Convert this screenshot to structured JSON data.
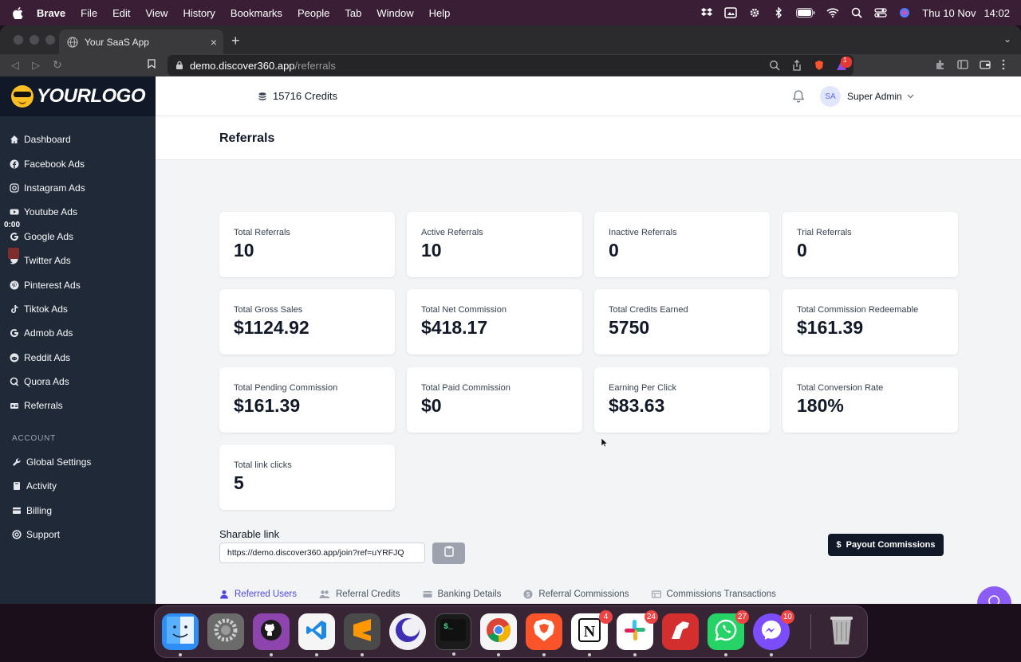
{
  "menubar": {
    "app_name": "Brave",
    "menus": [
      "File",
      "Edit",
      "View",
      "History",
      "Bookmarks",
      "People",
      "Tab",
      "Window",
      "Help"
    ],
    "date": "Thu 10 Nov",
    "time": "14:02"
  },
  "browser": {
    "tab_title": "Your SaaS App",
    "url_host": "demo.discover360.app",
    "url_path": "/referrals",
    "new_tab_symbol": "+",
    "shields_badge": "1"
  },
  "sidebar": {
    "logo_text": "YOURLOGO",
    "timer": "0:00",
    "items": [
      {
        "label": "Dashboard",
        "icon": "home-icon"
      },
      {
        "label": "Facebook Ads",
        "icon": "facebook-icon"
      },
      {
        "label": "Instagram Ads",
        "icon": "instagram-icon"
      },
      {
        "label": "Youtube Ads",
        "icon": "youtube-icon"
      },
      {
        "label": "Google Ads",
        "icon": "google-icon"
      },
      {
        "label": "Twitter Ads",
        "icon": "twitter-icon"
      },
      {
        "label": "Pinterest Ads",
        "icon": "pinterest-icon"
      },
      {
        "label": "Tiktok Ads",
        "icon": "tiktok-icon"
      },
      {
        "label": "Admob Ads",
        "icon": "admob-icon"
      },
      {
        "label": "Reddit Ads",
        "icon": "reddit-icon"
      },
      {
        "label": "Quora Ads",
        "icon": "quora-icon"
      },
      {
        "label": "Referrals",
        "icon": "referrals-icon"
      }
    ],
    "account_label": "ACCOUNT",
    "account_items": [
      {
        "label": "Global Settings",
        "icon": "wrench-icon"
      },
      {
        "label": "Activity",
        "icon": "book-icon"
      },
      {
        "label": "Billing",
        "icon": "billing-icon"
      },
      {
        "label": "Support",
        "icon": "support-icon"
      }
    ]
  },
  "header": {
    "credits": "15716 Credits",
    "avatar_initials": "SA",
    "user_name": "Super Admin"
  },
  "page": {
    "title": "Referrals"
  },
  "stats": [
    {
      "label": "Total Referrals",
      "value": "10"
    },
    {
      "label": "Active Referrals",
      "value": "10"
    },
    {
      "label": "Inactive Referrals",
      "value": "0"
    },
    {
      "label": "Trial Referrals",
      "value": "0"
    },
    {
      "label": "Total Gross Sales",
      "value": "$1124.92"
    },
    {
      "label": "Total Net Commission",
      "value": "$418.17"
    },
    {
      "label": "Total Credits Earned",
      "value": "5750"
    },
    {
      "label": "Total Commission Redeemable",
      "value": "$161.39"
    },
    {
      "label": "Total Pending Commission",
      "value": "$161.39"
    },
    {
      "label": "Total Paid Commission",
      "value": "$0"
    },
    {
      "label": "Earning Per Click",
      "value": "$83.63"
    },
    {
      "label": "Total Conversion Rate",
      "value": "180%"
    },
    {
      "label": "Total link clicks",
      "value": "5"
    }
  ],
  "share": {
    "label": "Sharable link",
    "link": "https://demo.discover360.app/join?ref=uYRFJQ"
  },
  "payout_button": "Payout Commissions",
  "tabs": [
    "Referred Users",
    "Referral Credits",
    "Banking Details",
    "Referral Commissions",
    "Commissions Transactions"
  ],
  "dock": [
    {
      "name": "Finder",
      "color": "#2f8ef5"
    },
    {
      "name": "System Preferences",
      "color": "#6b6b6b"
    },
    {
      "name": "GitHub Desktop",
      "color": "#8e44ad"
    },
    {
      "name": "VS Code",
      "color": "#1e88e5"
    },
    {
      "name": "Sublime Text",
      "color": "#4a4a4a"
    },
    {
      "name": "Arc",
      "color": "#f0f0f5"
    },
    {
      "name": "Terminal",
      "color": "#1b1b1b"
    },
    {
      "name": "Chrome",
      "color": "#f5f5f5"
    },
    {
      "name": "Brave",
      "color": "#fb542b"
    },
    {
      "name": "Notion",
      "color": "#ffffff",
      "badge": "4"
    },
    {
      "name": "Slack",
      "color": "#ffffff",
      "badge": "24"
    },
    {
      "name": "Paw",
      "color": "#d32f2f"
    },
    {
      "name": "WhatsApp",
      "color": "#25d366",
      "badge": "27"
    },
    {
      "name": "Messenger",
      "color": "#7b4dff",
      "badge": "10"
    },
    {
      "name": "Trash",
      "color": "#8a8a8a"
    }
  ]
}
